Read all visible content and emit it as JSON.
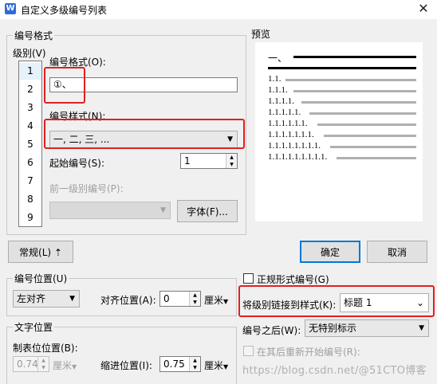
{
  "window": {
    "title": "自定义多级编号列表",
    "close_glyph": "✕",
    "app_icon": "W"
  },
  "numbering_group": {
    "label": "编号格式",
    "level_label": "级别(V)",
    "levels": [
      "1",
      "2",
      "3",
      "4",
      "5",
      "6",
      "7",
      "8",
      "9"
    ],
    "selected_level": "1",
    "format_label": "编号格式(O):",
    "format_value": "①、",
    "style_label": "编号样式(N):",
    "style_value": "一, 二, 三, ...",
    "start_label": "起始编号(S):",
    "start_value": "1",
    "prev_level_label": "前一级别编号(P):",
    "prev_level_value": "",
    "font_button": "字体(F)..."
  },
  "preview": {
    "label": "预览",
    "first_line": "一、",
    "lines": [
      "1.1.",
      "1.1.1.",
      "1.1.1.1.",
      "1.1.1.1.1.",
      "1.1.1.1.1.1.",
      "1.1.1.1.1.1.1.",
      "1.1.1.1.1.1.1.1.",
      "1.1.1.1.1.1.1.1.1."
    ]
  },
  "buttons": {
    "normal": "常规(L)",
    "normal_icon": "⇡",
    "ok": "确定",
    "cancel": "取消"
  },
  "position_group": {
    "label": "编号位置(U)",
    "align_value": "左对齐",
    "align_pos_label": "对齐位置(A):",
    "align_pos_value": "0",
    "unit": "厘米"
  },
  "text_position_group": {
    "label": "文字位置",
    "tab_label": "制表位位置(B):",
    "tab_value": "0.74",
    "tab_unit": "厘米",
    "indent_label": "缩进位置(I):",
    "indent_value": "0.75",
    "indent_unit": "厘米"
  },
  "options": {
    "legal_label": "正规形式编号(G)",
    "legal_checked": false,
    "link_label": "将级别链接到样式(K):",
    "link_value": "标题 1",
    "after_label": "编号之后(W):",
    "after_value": "无特别标示",
    "restart_label": "在其后重新开始编号(R):",
    "restart_checked": false
  },
  "watermark": "https://blog.csdn.net/@51CTO博客"
}
